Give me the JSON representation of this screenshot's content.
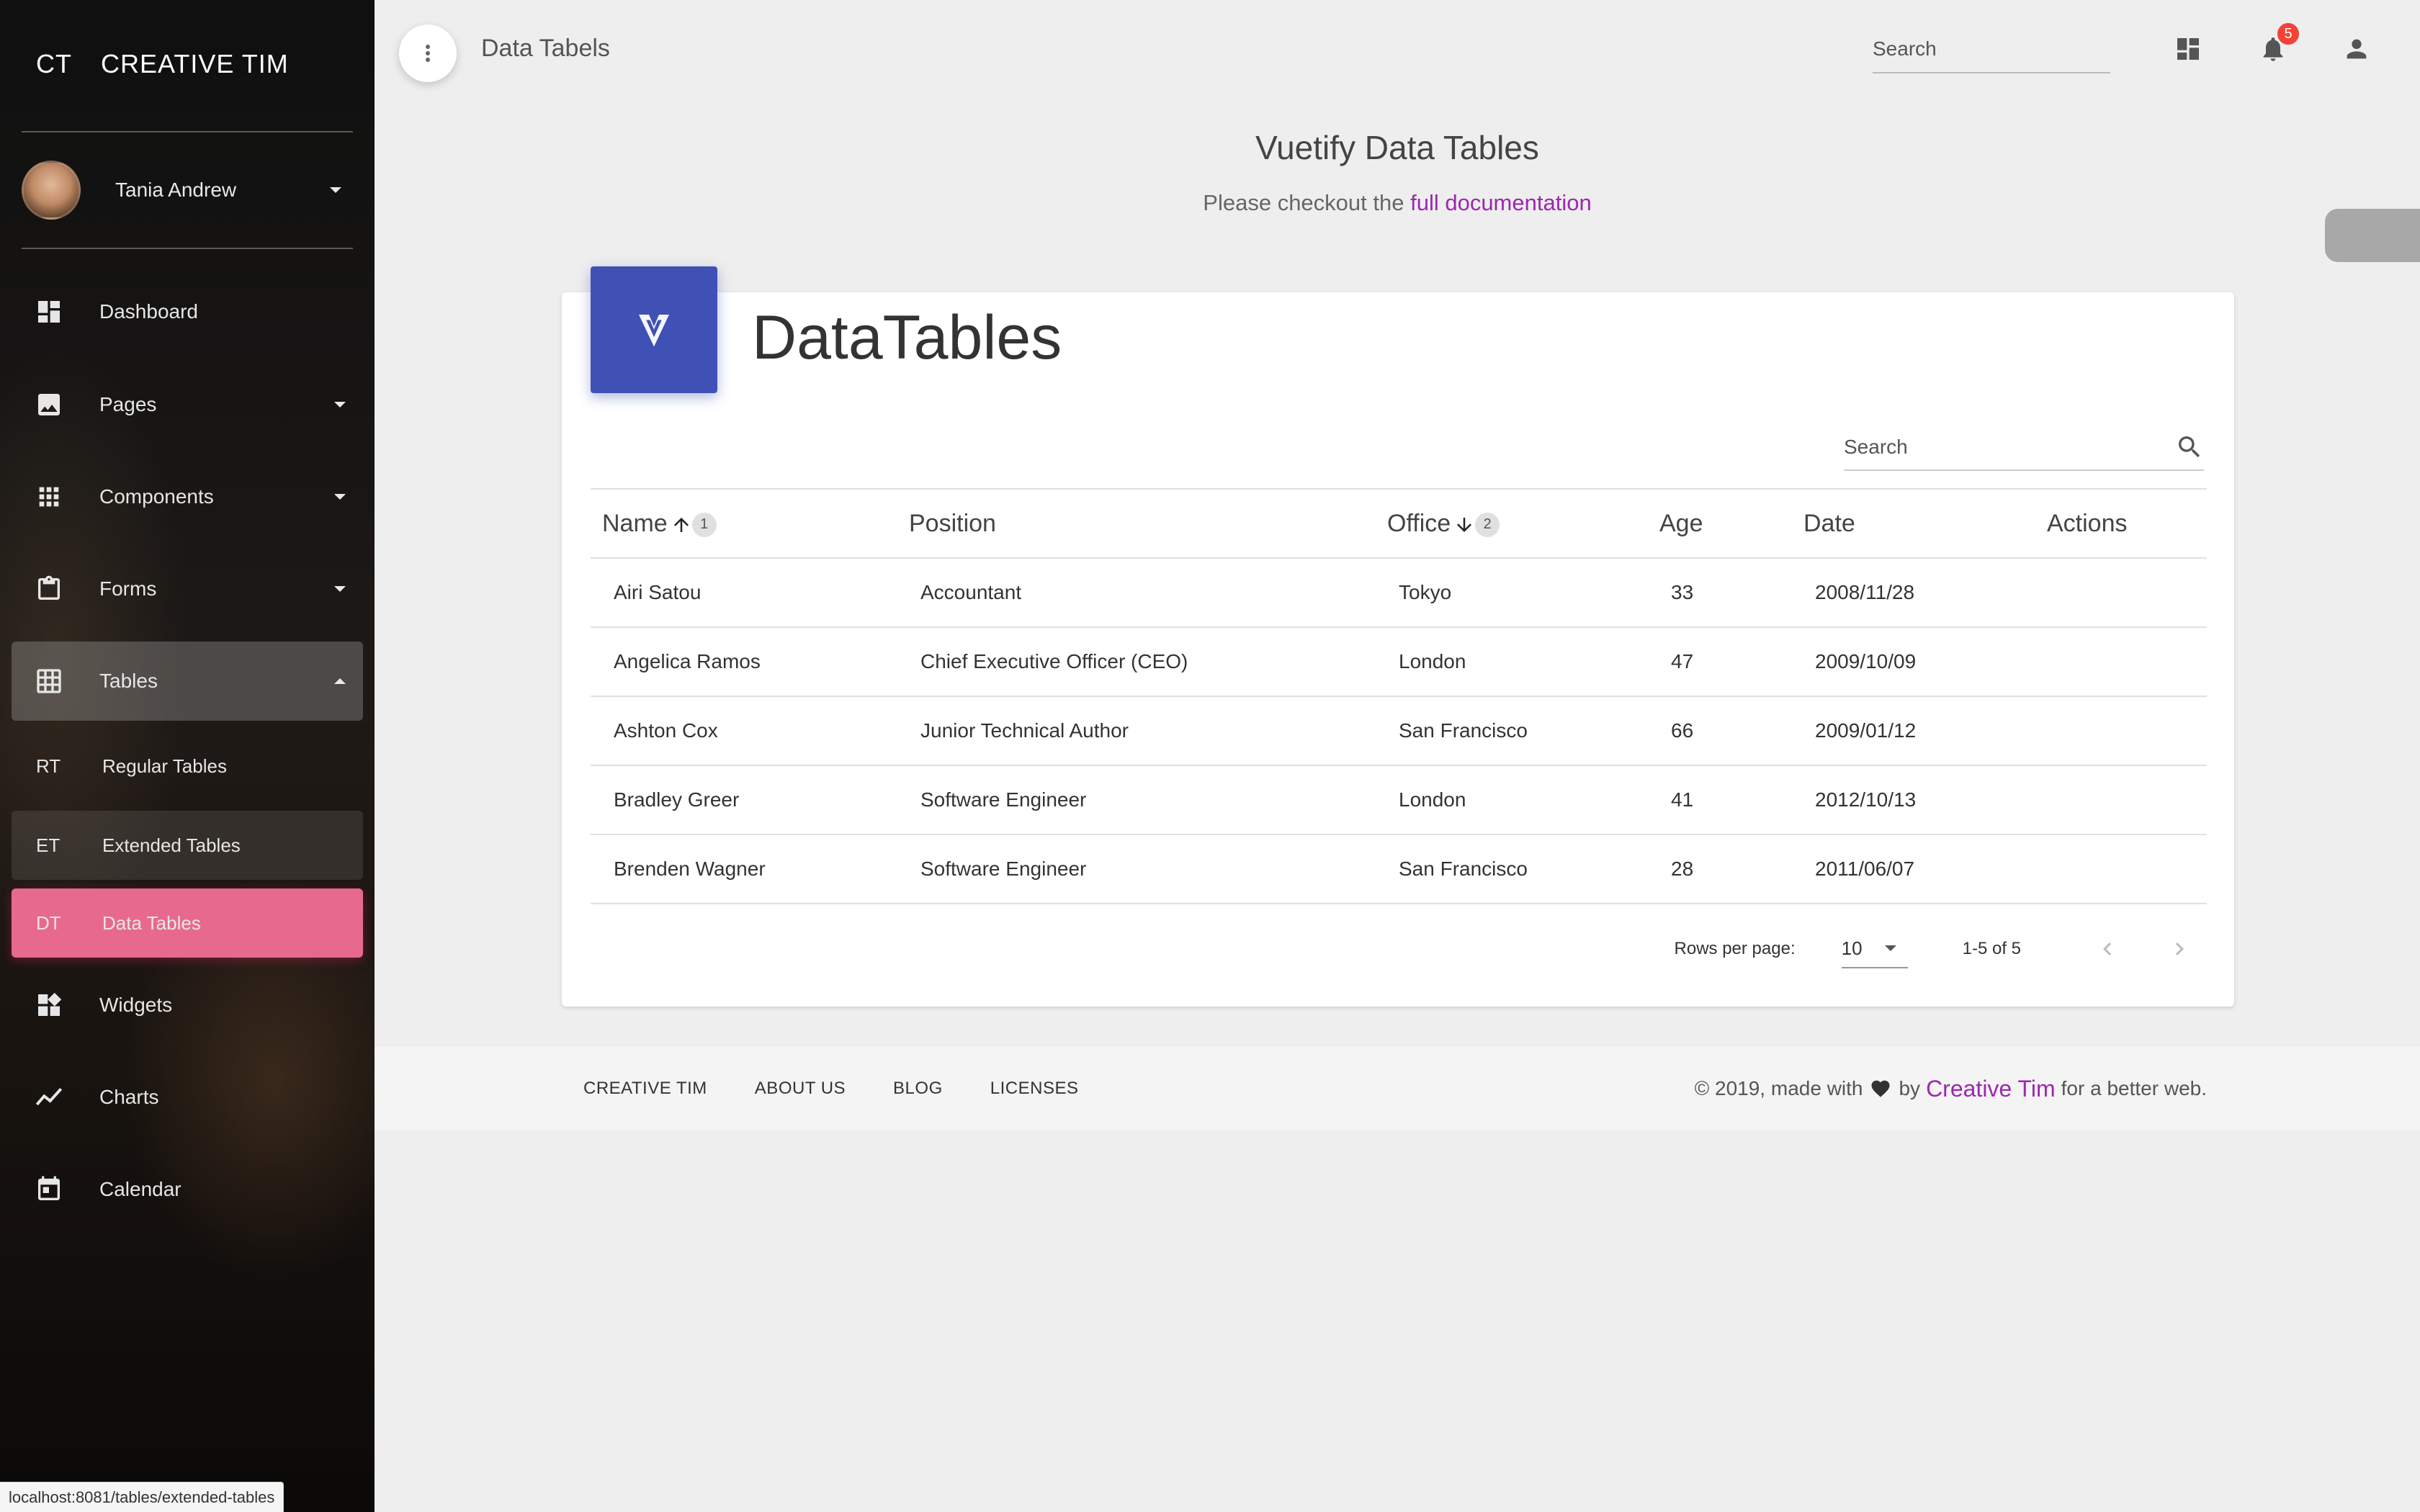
{
  "sidebar": {
    "brand_mini": "CT",
    "brand_name": "CREATIVE TIM",
    "user_name": "Tania Andrew",
    "items": [
      {
        "label": "Dashboard"
      },
      {
        "label": "Pages"
      },
      {
        "label": "Components"
      },
      {
        "label": "Forms"
      },
      {
        "label": "Tables"
      },
      {
        "label": "Widgets"
      },
      {
        "label": "Charts"
      },
      {
        "label": "Calendar"
      }
    ],
    "sub_items": [
      {
        "mini": "RT",
        "label": "Regular Tables"
      },
      {
        "mini": "ET",
        "label": "Extended Tables"
      },
      {
        "mini": "DT",
        "label": "Data Tables"
      }
    ],
    "status_url": "localhost:8081/tables/extended-tables"
  },
  "topbar": {
    "title": "Data Tabels",
    "search_placeholder": "Search",
    "notification_count": "5"
  },
  "header": {
    "heading": "Vuetify Data Tables",
    "sub_prefix": "Please checkout the ",
    "sub_link": "full documentation"
  },
  "card": {
    "title": "DataTables",
    "search_placeholder": "Search",
    "columns": [
      "Name",
      "Position",
      "Office",
      "Age",
      "Date",
      "Actions"
    ],
    "sort": {
      "name_order": "1",
      "office_order": "2"
    },
    "rows": [
      {
        "name": "Airi Satou",
        "position": "Accountant",
        "office": "Tokyo",
        "age": "33",
        "date": "2008/11/28"
      },
      {
        "name": "Angelica Ramos",
        "position": "Chief Executive Officer (CEO)",
        "office": "London",
        "age": "47",
        "date": "2009/10/09"
      },
      {
        "name": "Ashton Cox",
        "position": "Junior Technical Author",
        "office": "San Francisco",
        "age": "66",
        "date": "2009/01/12"
      },
      {
        "name": "Bradley Greer",
        "position": "Software Engineer",
        "office": "London",
        "age": "41",
        "date": "2012/10/13"
      },
      {
        "name": "Brenden Wagner",
        "position": "Software Engineer",
        "office": "San Francisco",
        "age": "28",
        "date": "2011/06/07"
      }
    ],
    "footer": {
      "rows_per_page_label": "Rows per page:",
      "rows_per_page_value": "10",
      "page_info": "1-5 of 5"
    }
  },
  "footer": {
    "links": [
      "CREATIVE TIM",
      "ABOUT US",
      "BLOG",
      "LICENSES"
    ],
    "copyright_prefix": "© 2019, made with",
    "copyright_by": "by",
    "copyright_brand": "Creative Tim",
    "copyright_suffix": "for a better web."
  },
  "colors": {
    "active_item": "#e8698e",
    "card_icon": "#3f51b5",
    "link": "#9c27b0",
    "badge": "#f44336"
  }
}
